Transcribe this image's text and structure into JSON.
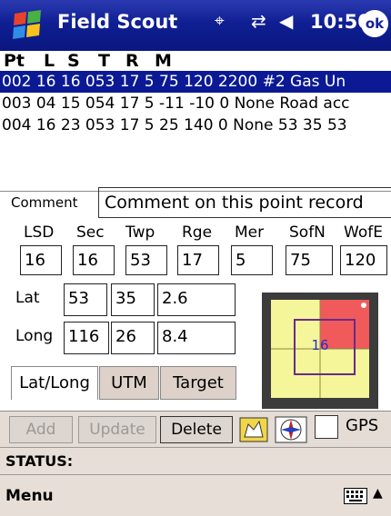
{
  "titlebar": {
    "app_title": "Field Scout",
    "clock": "10:50",
    "ok_label": "ok"
  },
  "list": {
    "columns": [
      "Pt",
      "L",
      "S",
      "T",
      "R",
      "M"
    ],
    "rows": [
      {
        "text": "002 16 16 053 17 5 75 120 2200 #2 Gas Un",
        "selected": true
      },
      {
        "text": "003 04 15 054 17 5 -11 -10 0 None Road acc",
        "selected": false
      },
      {
        "text": "004 16 23 053 17 5 25 140 0 None  53 35 53",
        "selected": false
      }
    ]
  },
  "comment": {
    "label": "Comment",
    "value": "Comment on this point record"
  },
  "location": {
    "labels": {
      "lsd": "LSD",
      "sec": "Sec",
      "twp": "Twp",
      "rge": "Rge",
      "mer": "Mer",
      "sofn": "SofN",
      "wofe": "WofE"
    },
    "values": {
      "lsd": "16",
      "sec": "16",
      "twp": "53",
      "rge": "17",
      "mer": "5",
      "sofn": "75",
      "wofe": "120"
    }
  },
  "coords": {
    "lat_label": "Lat",
    "long_label": "Long",
    "lat": {
      "deg": "53",
      "min": "35",
      "sec": "2.6"
    },
    "long": {
      "deg": "116",
      "min": "26",
      "sec": "8.4"
    }
  },
  "grid": {
    "lsd_number": "16",
    "colors": {
      "background": "#3c3c3c",
      "cell": "#f5f59a",
      "highlight": "#f05a5a",
      "outline": "#6a2a8a",
      "number": "#2a2acc"
    }
  },
  "tabs": [
    {
      "label": "Lat/Long",
      "active": true
    },
    {
      "label": "UTM",
      "active": false
    },
    {
      "label": "Target",
      "active": false
    }
  ],
  "actions": {
    "add": "Add",
    "update": "Update",
    "delete": "Delete",
    "gps_label": "GPS"
  },
  "status": {
    "label": "STATUS:"
  },
  "menu": {
    "label": "Menu"
  },
  "colors": {
    "titlebar": "#0f1f93",
    "selection": "#0b1a94",
    "toolbar": "#e4dcd5"
  }
}
